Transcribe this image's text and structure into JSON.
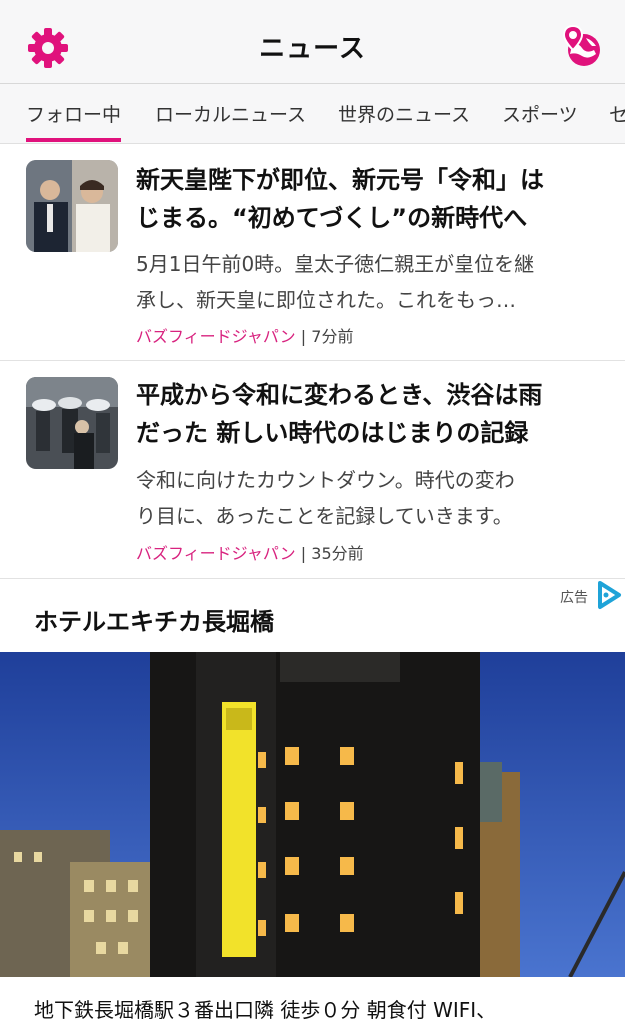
{
  "header": {
    "title": "ニュース",
    "settings_icon": "gear-icon",
    "location_icon": "globe-pin-icon",
    "accent_color": "#e0127c"
  },
  "tabs": [
    {
      "label": "フォロー中",
      "active": true
    },
    {
      "label": "ローカルニュース",
      "active": false
    },
    {
      "label": "世界のニュース",
      "active": false
    },
    {
      "label": "スポーツ",
      "active": false
    },
    {
      "label": "セ",
      "active": false
    }
  ],
  "articles": [
    {
      "title_line1": "新天皇陛下が即位、新元号「令和」は",
      "title_line2": "じまる。“初めてづくし”の新時代へ",
      "desc_line1": "5月1日午前0時。皇太子徳仁親王が皇位を継",
      "desc_line2": "承し、新天皇に即位された。これをもっ…",
      "source": "バズフィードジャパン",
      "separator": "|",
      "time": "7分前"
    },
    {
      "title_line1": "平成から令和に変わるとき、渋谷は雨",
      "title_line2": "だった 新しい時代のはじまりの記録",
      "desc_line1": "令和に向けたカウントダウン。時代の変わ",
      "desc_line2": "り目に、あったことを記録していきます。",
      "source": "バズフィードジャパン",
      "separator": "|",
      "time": "35分前"
    }
  ],
  "ad": {
    "label": "広告",
    "title": "ホテルエキチカ長堀橋",
    "description": "地下鉄長堀橋駅３番出口隣 徒歩０分 朝食付 WIFI、"
  }
}
